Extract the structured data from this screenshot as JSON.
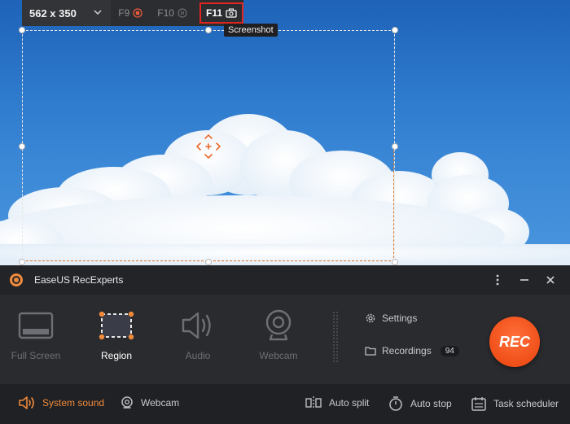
{
  "toolbar": {
    "size_value": "562 x 350",
    "f9_label": "F9",
    "f10_label": "F10",
    "f11_label": "F11",
    "tooltip": "Screenshot"
  },
  "app": {
    "title": "EaseUS RecExperts"
  },
  "modes": [
    {
      "label": "Full Screen",
      "selected": false
    },
    {
      "label": "Region",
      "selected": true
    },
    {
      "label": "Audio",
      "selected": false
    },
    {
      "label": "Webcam",
      "selected": false
    }
  ],
  "side": {
    "settings_label": "Settings",
    "recordings_label": "Recordings",
    "recordings_count": "94"
  },
  "rec_label": "REC",
  "bottom": {
    "system_sound": "System sound",
    "webcam": "Webcam",
    "auto_split": "Auto split",
    "auto_stop": "Auto stop",
    "task_scheduler": "Task scheduler"
  },
  "colors": {
    "accent": "#f05a22",
    "selection_border": "#e07a35",
    "highlight_box": "#e0261f"
  }
}
